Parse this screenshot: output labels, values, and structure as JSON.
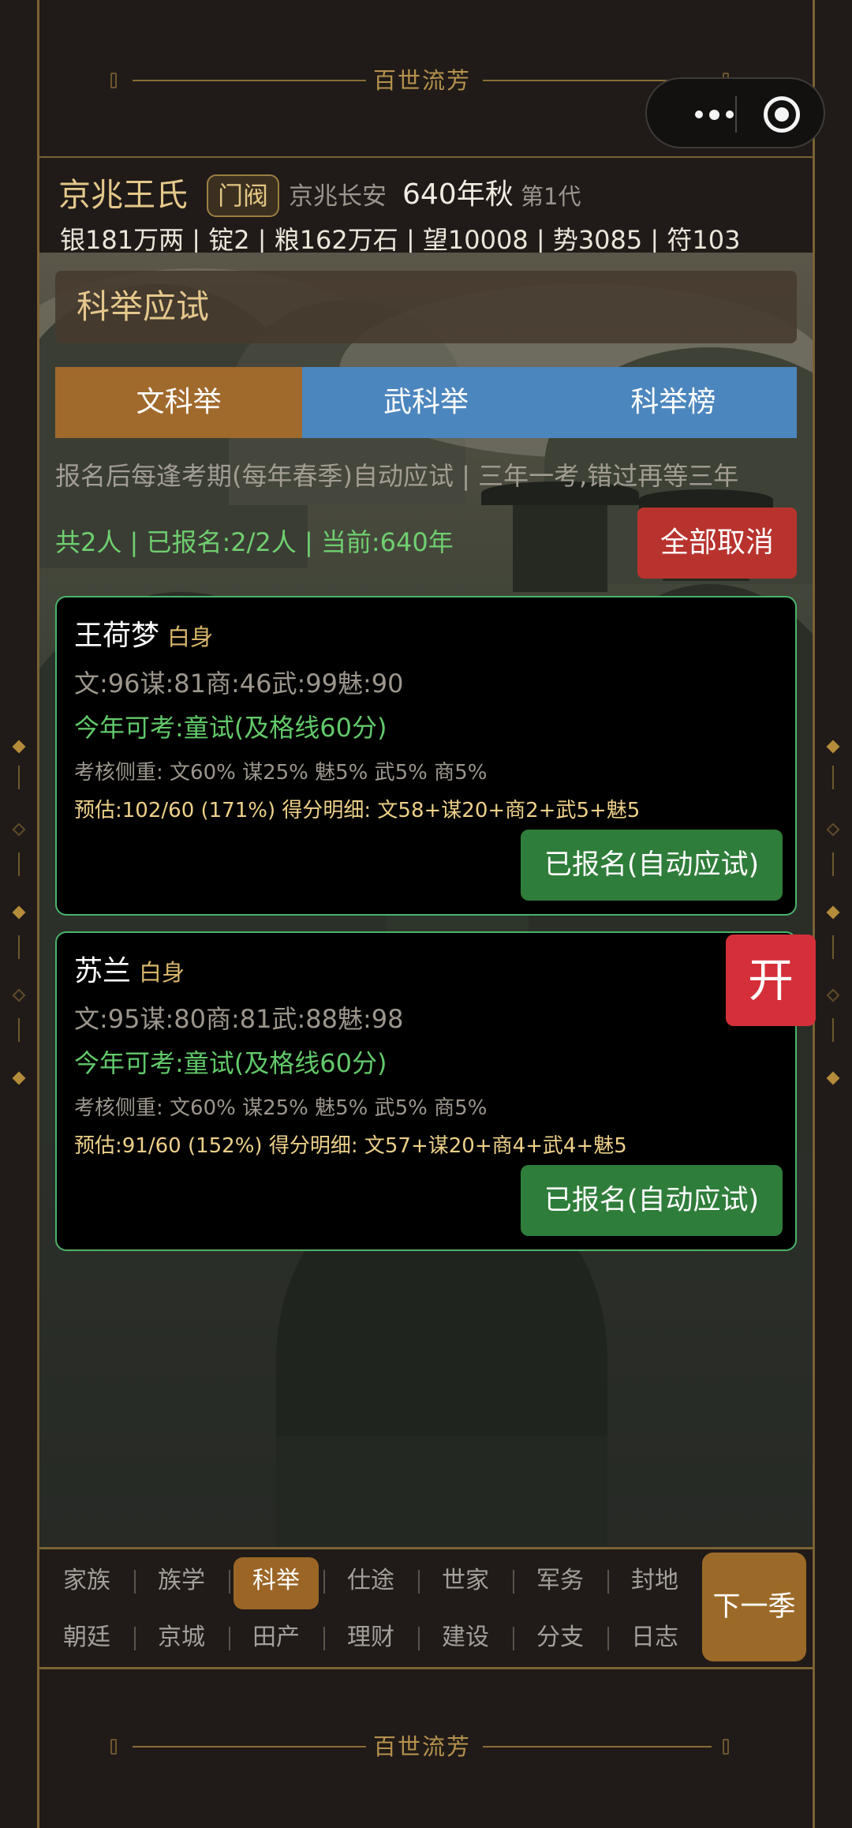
{
  "app": {
    "banner_text": "百世流芳"
  },
  "header": {
    "clan_name": "京兆王氏",
    "rank_badge": "门阀",
    "location": "京兆长安",
    "year_season": "640年秋",
    "generation": "第1代",
    "stats": "银181万两 | 锭2 | 粮162万石 | 望10008 | 势3085 | 符103"
  },
  "section": {
    "title": "科举应试",
    "tabs": [
      {
        "label": "文科举",
        "active": true
      },
      {
        "label": "武科举",
        "active": false
      },
      {
        "label": "科举榜",
        "active": false
      }
    ],
    "hint": "报名后每逢考期(每年春季)自动应试 | 三年一考,错过再等三年",
    "summary": "共2人 | 已报名:2/2人 | 当前:640年",
    "cancel_all_label": "全部取消"
  },
  "candidates": [
    {
      "name": "王荷梦",
      "status": "白身",
      "attributes": "文:96谋:81商:46武:99魅:90",
      "exam_line": "今年可考:童试(及格线60分)",
      "weights": "考核侧重: 文60% 谋25% 魅5% 武5% 商5%",
      "estimate": "预估:102/60 (171%)  得分明细: 文58+谋20+商2+武5+魅5",
      "button_label": "已报名(自动应试)"
    },
    {
      "name": "苏兰",
      "status": "白身",
      "attributes": "文:95谋:80商:81武:88魅:98",
      "exam_line": "今年可考:童试(及格线60分)",
      "weights": "考核侧重: 文60% 谋25% 魅5% 武5% 商5%",
      "estimate": "预估:91/60 (152%)  得分明细: 文57+谋20+商4+武4+魅5",
      "button_label": "已报名(自动应试)"
    }
  ],
  "open_button_label": "开",
  "nav": {
    "row1": [
      "家族",
      "族学",
      "科举",
      "仕途",
      "世家",
      "军务",
      "封地"
    ],
    "row2": [
      "朝廷",
      "京城",
      "田产",
      "理财",
      "建设",
      "分支",
      "日志"
    ],
    "active": "科举",
    "next_season_label": "下一季"
  },
  "colors": {
    "gold": "#e5c78c",
    "tab_active": "#a16a2d",
    "tab_inactive": "#4c86be",
    "green_text": "#6fcf6f",
    "registered_button": "#2f7d3a",
    "cancel_button": "#b8332e",
    "open_button": "#d5303a"
  },
  "icons": [
    "more-dots-icon",
    "close-target-icon"
  ]
}
